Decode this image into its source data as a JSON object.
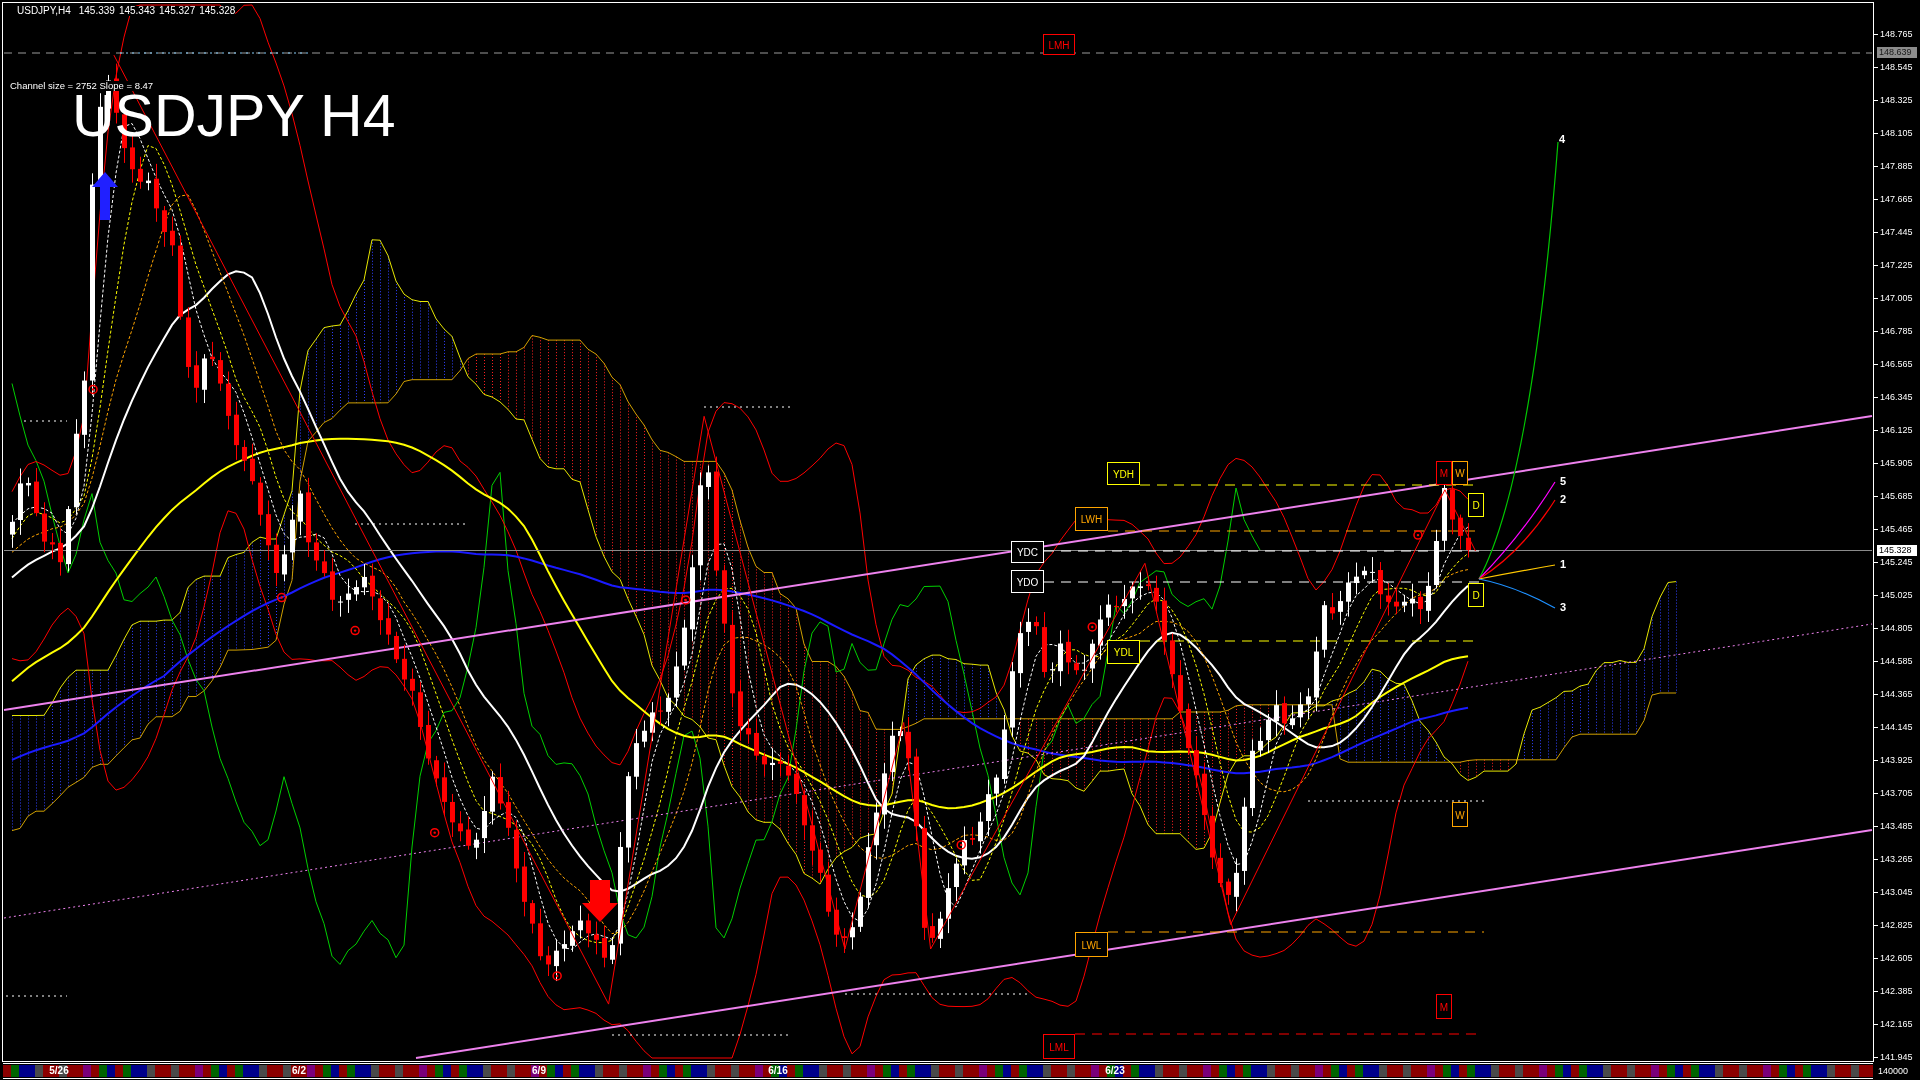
{
  "header": {
    "symbol": "USDJPY,H4",
    "quotes": [
      "145.339",
      "145.343",
      "145.327",
      "145.328"
    ]
  },
  "channel_info": "Channel size = 2752 Slope = 8.47",
  "chart_title": "USDJPY H4",
  "levels": [
    {
      "label": "LMH",
      "color": "#ff0000"
    },
    {
      "label": "YDH",
      "color": "#ffff00"
    },
    {
      "label": "M",
      "color": "#ff0000"
    },
    {
      "label": "W",
      "color": "#ffa500"
    },
    {
      "label": "D",
      "color": "#ffff00"
    },
    {
      "label": "LWH",
      "color": "#ffa500"
    },
    {
      "label": "YDC",
      "color": "#ffffff"
    },
    {
      "label": "YDO",
      "color": "#ffffff"
    },
    {
      "label": "D",
      "color": "#ffff00"
    },
    {
      "label": "YDL",
      "color": "#ffff00"
    },
    {
      "label": "W",
      "color": "#ffa500"
    },
    {
      "label": "LWL",
      "color": "#ffa500"
    },
    {
      "label": "M",
      "color": "#ff0000"
    },
    {
      "label": "LML",
      "color": "#ff0000"
    }
  ],
  "projections": [
    {
      "label": "4",
      "color": "#00c800"
    },
    {
      "label": "5",
      "color": "#ff00ff"
    },
    {
      "label": "2",
      "color": "#ff0000"
    },
    {
      "label": "1",
      "color": "#ffc800"
    },
    {
      "label": "3",
      "color": "#1e90ff"
    }
  ],
  "price_axis": {
    "ticks": [
      "148.765",
      "148.545",
      "148.325",
      "148.105",
      "147.885",
      "147.665",
      "147.445",
      "147.225",
      "147.005",
      "146.785",
      "146.565",
      "146.345",
      "146.125",
      "145.905",
      "145.685",
      "145.465",
      "145.245",
      "145.025",
      "144.805",
      "144.585",
      "144.365",
      "144.145",
      "143.925",
      "143.705",
      "143.485",
      "143.265",
      "143.045",
      "142.825",
      "142.605",
      "142.385",
      "142.165",
      "141.945"
    ],
    "markers": [
      {
        "label": "148.639",
        "kind": "level"
      },
      {
        "label": "145.328",
        "kind": "bid"
      }
    ]
  },
  "time_axis": {
    "dates": [
      "5/26",
      "6/2",
      "6/9",
      "6/16",
      "6/23"
    ]
  },
  "volume_scale": "140000"
}
